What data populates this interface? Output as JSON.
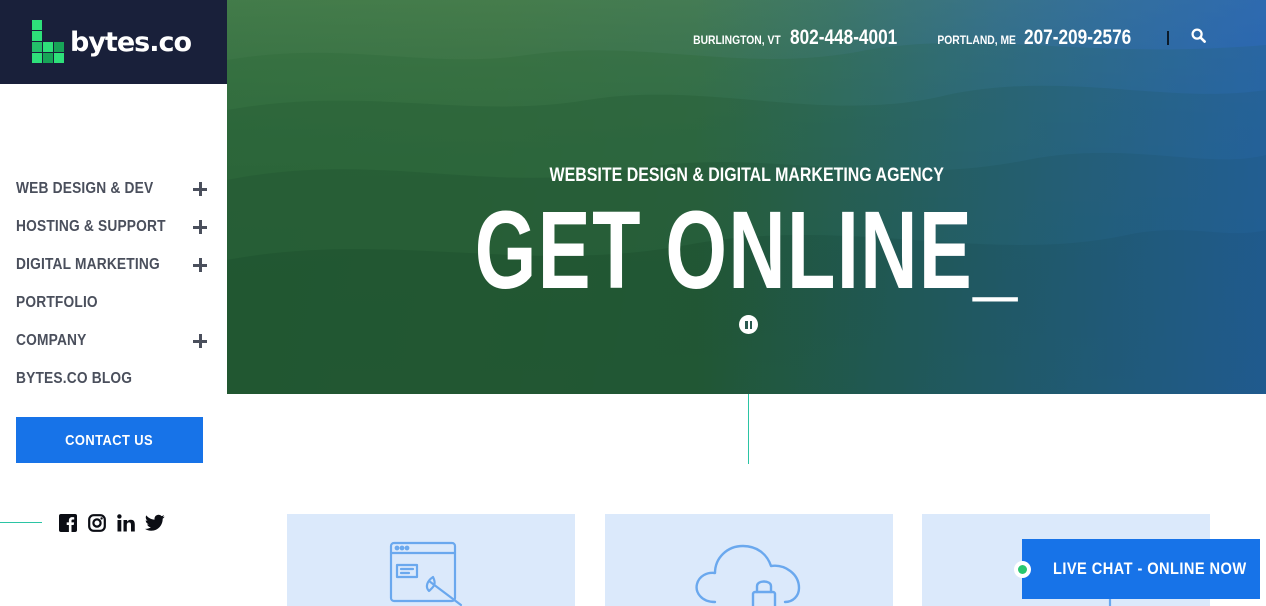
{
  "brand": {
    "name": "bytes.co",
    "logo_bg": "#19203a",
    "logo_green": "#2ee07a"
  },
  "nav": {
    "items": [
      {
        "label": "WEB DESIGN & DEV",
        "expandable": true
      },
      {
        "label": "HOSTING & SUPPORT",
        "expandable": true
      },
      {
        "label": "DIGITAL MARKETING",
        "expandable": true
      },
      {
        "label": "PORTFOLIO",
        "expandable": false
      },
      {
        "label": "COMPANY",
        "expandable": true
      },
      {
        "label": "BYTES.CO BLOG",
        "expandable": false
      }
    ],
    "contact_label": "CONTACT US"
  },
  "social": {
    "icons": [
      "facebook-icon",
      "instagram-icon",
      "linkedin-icon",
      "twitter-icon"
    ]
  },
  "header": {
    "city1": "BURLINGTON, VT",
    "phone1": "802-448-4001",
    "city2": "PORTLAND, ME",
    "phone2": "207-209-2576"
  },
  "hero": {
    "tagline": "WEBSITE DESIGN & DIGITAL MARKETING AGENCY",
    "headline": "GET ONLINE_"
  },
  "cards": {
    "icons": [
      "website-design-icon",
      "cloud-hosting-icon",
      "marketing-icon"
    ]
  },
  "chat": {
    "label": "LIVE CHAT - ONLINE NOW",
    "status_color": "#28c76f"
  },
  "colors": {
    "accent": "#1773e8",
    "teal_line": "#2bc4a4",
    "card_bg": "#dbe9fb"
  }
}
